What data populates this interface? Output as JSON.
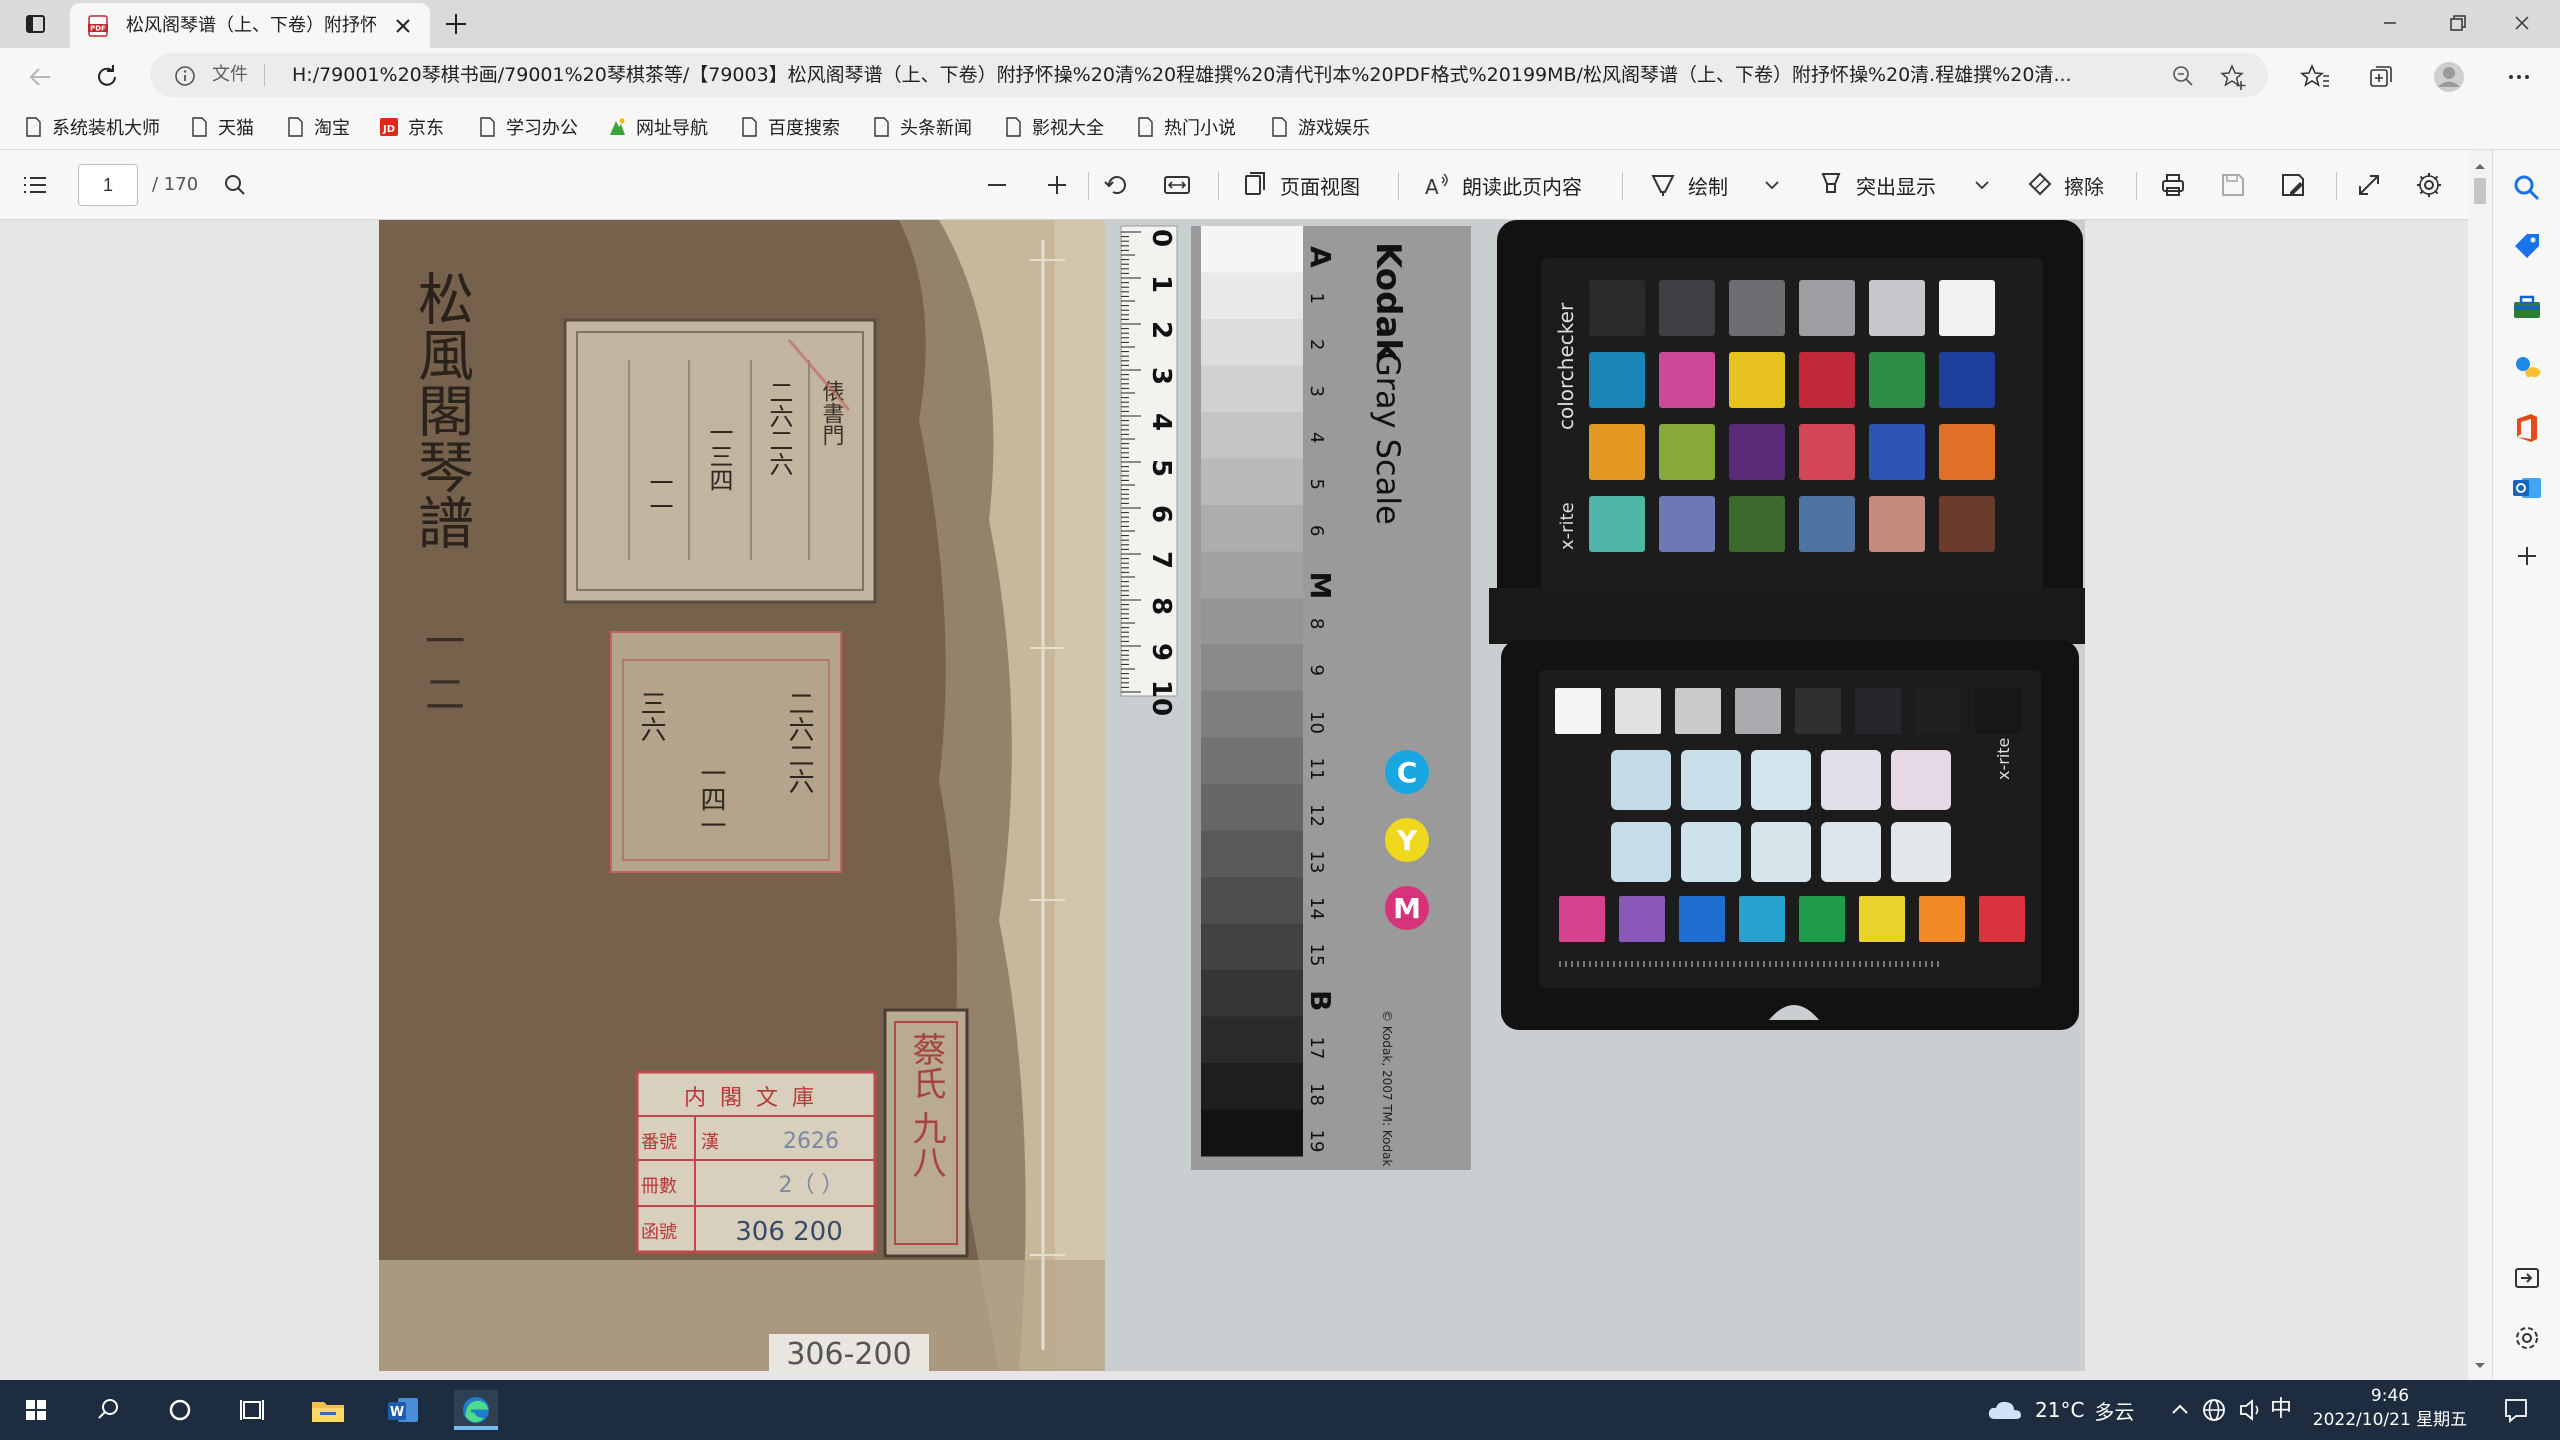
{
  "browser": {
    "tab": {
      "title": "松风阁琴谱（上、下卷）附抒怀操 清程雄撰 清代刊本",
      "favicon": "pdf-icon"
    },
    "new_tab_glyph": "+",
    "address": {
      "scheme_label": "文件",
      "url": "H:/79001%20琴棋书画/79001%20琴棋茶等/【79003】松风阁琴谱（上、下卷）附抒怀操%20清%20程雄撰%20清代刊本%20PDF格式%20199MB/松风阁琴谱（上、下卷）附抒怀操%20清.程雄撰%20清..."
    },
    "bookmarks": [
      {
        "label": "系统装机大师",
        "icon": "page-icon"
      },
      {
        "label": "天猫",
        "icon": "page-icon"
      },
      {
        "label": "淘宝",
        "icon": "page-icon"
      },
      {
        "label": "京东",
        "icon": "jd-icon"
      },
      {
        "label": "学习办公",
        "icon": "page-icon"
      },
      {
        "label": "网址导航",
        "icon": "nav-icon"
      },
      {
        "label": "百度搜索",
        "icon": "page-icon"
      },
      {
        "label": "头条新闻",
        "icon": "page-icon"
      },
      {
        "label": "影视大全",
        "icon": "page-icon"
      },
      {
        "label": "热门小说",
        "icon": "page-icon"
      },
      {
        "label": "游戏娱乐",
        "icon": "page-icon"
      }
    ]
  },
  "pdf_toolbar": {
    "page_current": "1",
    "page_total": "/ 170",
    "page_view": "页面视图",
    "read_aloud": "朗读此页内容",
    "draw": "绘制",
    "highlight": "突出显示",
    "erase": "擦除"
  },
  "document": {
    "title_vertical": "松風閣琴譜",
    "volume_mark": "一 二",
    "label_top_cols": [
      "俵書門",
      "二六二六",
      "一三四",
      "一一"
    ],
    "label_middle_cols": [
      "二六二六",
      "三六",
      "一四一"
    ],
    "catalog_label": {
      "header": "内閣文庫",
      "rows": [
        {
          "key": "番號",
          "prefix": "漢",
          "value": "2626"
        },
        {
          "key": "冊數",
          "prefix": "",
          "value": "2（ ）"
        },
        {
          "key": "函號",
          "prefix": "",
          "value": "306 200"
        }
      ]
    },
    "side_label": "蔡氏 九八",
    "bottom_label": "306-200",
    "ruler_numbers": [
      "0",
      "1",
      "2",
      "3",
      "4",
      "5",
      "6",
      "7",
      "8",
      "9",
      "10"
    ],
    "grayscale": {
      "brand": "Kodak",
      "name": "Gray Scale",
      "marks": [
        "A",
        "1",
        "2",
        "3",
        "4",
        "5",
        "6",
        "M",
        "8",
        "9",
        "10",
        "11",
        "12",
        "13",
        "14",
        "15",
        "B",
        "17",
        "18",
        "19"
      ],
      "cym": [
        "C",
        "Y",
        "M"
      ],
      "copyright": "© Kodak, 2007 TM: Kodak"
    },
    "colorchecker": {
      "brand": "colorchecker",
      "maker": "x-rite",
      "swatches": [
        "#2a2a2b",
        "#3f4044",
        "#6b6d70",
        "#9c9ea2",
        "#c6c8cb",
        "#f1f1f0",
        "#1a86b8",
        "#d0489a",
        "#e8c21f",
        "#c2283a",
        "#2e8e48",
        "#1e3f9c",
        "#e49a22",
        "#87a93b",
        "#5a2b78",
        "#d34658",
        "#2d55b3",
        "#e07028",
        "#4fb6a8",
        "#6f77b7",
        "#3c6a2c",
        "#4f74a4",
        "#c78b7e",
        "#6b3c2c"
      ],
      "swatches_lower_top": [
        "#f4f4f4",
        "#e1e2e3",
        "#c9cacc",
        "#a9abae",
        "#2f3032",
        "#26272a",
        "#1f2022",
        "#161718"
      ],
      "swatches_lower_bottom": [
        "#d6428e",
        "#8a58b8",
        "#1f6fd2",
        "#2aa2cf",
        "#1f9c4a",
        "#e9d22b",
        "#ef8a24",
        "#d8333f"
      ],
      "light_patches": [
        "#c3dbe8",
        "#c9e0ea",
        "#d3e4ec",
        "#e2dfe9",
        "#e6d8e4",
        "#c4dde8",
        "#cde2eb",
        "#d6e5ec",
        "#dde4ea",
        "#e3e7ea"
      ]
    }
  },
  "taskbar": {
    "weather_temp": "21°C",
    "weather_text": "多云",
    "ime": "中",
    "time": "9:46",
    "date": "2022/10/21 星期五"
  }
}
